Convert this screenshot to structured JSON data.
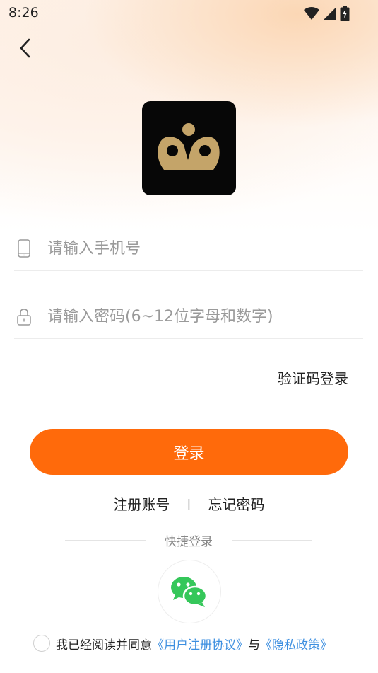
{
  "status_bar": {
    "time": "8:26"
  },
  "icons": {
    "back": "chevron-left-icon",
    "wifi": "wifi-icon",
    "signal": "signal-icon",
    "battery": "battery-charging-icon",
    "phone": "phone-icon",
    "lock": "lock-icon",
    "wechat": "wechat-icon"
  },
  "form": {
    "phone_placeholder": "请输入手机号",
    "password_placeholder": "请输入密码(6~12位字母和数字)",
    "sms_login_label": "验证码登录",
    "login_button_label": "登录"
  },
  "links": {
    "register_label": "注册账号",
    "separator": "|",
    "forgot_password_label": "忘记密码"
  },
  "quick_login": {
    "title": "快捷登录"
  },
  "agreement": {
    "prefix": "我已经阅读并同意",
    "user_agreement": "《用户注册协议》",
    "conjunction": "与",
    "privacy_policy": "《隐私政策》",
    "checked": false
  },
  "colors": {
    "accent": "#ff6a0b",
    "link": "#3d8fe0",
    "wechat": "#35c75a",
    "logo_gold": "#c4a469"
  }
}
